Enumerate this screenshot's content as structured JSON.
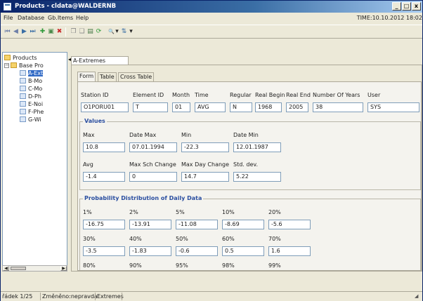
{
  "window": {
    "title": "Products - cldata@WALDERNB",
    "minimize": "_",
    "maximize": "□",
    "close": "x"
  },
  "menu": {
    "items": [
      "File",
      "Database",
      "Gb.Items",
      "Help"
    ],
    "time_display": "TIME:10.10.2012 18:02"
  },
  "toolbar": {
    "buttons": [
      {
        "icon": "first-record-icon",
        "glyph": "⏮"
      },
      {
        "icon": "prev-record-icon",
        "glyph": "◀"
      },
      {
        "icon": "next-record-icon",
        "glyph": "▶"
      },
      {
        "icon": "last-record-icon",
        "glyph": "⏭"
      },
      {
        "icon": "add-record-icon",
        "glyph": "✚"
      },
      {
        "icon": "save-record-icon",
        "glyph": "▣"
      },
      {
        "icon": "delete-record-icon",
        "glyph": "✖"
      },
      {
        "icon": "copy-icon",
        "glyph": "❐"
      },
      {
        "icon": "paste-icon",
        "glyph": "❑"
      },
      {
        "icon": "print-icon",
        "glyph": "▤"
      },
      {
        "icon": "refresh-icon",
        "glyph": "⟳"
      },
      {
        "icon": "search-icon",
        "glyph": "🔍"
      },
      {
        "icon": "filter-icon",
        "glyph": "▾"
      },
      {
        "icon": "sort-icon",
        "glyph": "⇅"
      },
      {
        "icon": "dropdown-icon",
        "glyph": "▾"
      }
    ]
  },
  "tree": {
    "root": "Products",
    "child": "Base Pro",
    "items": [
      "A-Ext",
      "B-Mo",
      "C-Mo",
      "D-Ph",
      "E-Noi",
      "F-Phe",
      "G-Wi"
    ],
    "selected_index": 0
  },
  "document_tab": "A-Extremes",
  "subtabs": [
    "Form",
    "Table",
    "Cross Table"
  ],
  "header_fields": {
    "labels": [
      "Station ID",
      "Element ID",
      "Month",
      "Time",
      "Regular",
      "Real Begin",
      "Real End",
      "Number Of Years",
      "User"
    ],
    "values": [
      "O1PORU01",
      "T",
      "01",
      "AVG",
      "N",
      "1968",
      "2005",
      "38",
      "SYS"
    ]
  },
  "values_group": {
    "title": "Values",
    "row1_labels": [
      "Max",
      "Date Max",
      "Min",
      "Date Min"
    ],
    "row1_values": [
      "10.8",
      "07.01.1994",
      "-22.3",
      "12.01.1987"
    ],
    "row2_labels": [
      "Avg",
      "Max Sch Change",
      "Max Day Change",
      "Std. dev."
    ],
    "row2_values": [
      "-1.4",
      "0",
      "14.7",
      "5.22"
    ]
  },
  "probability_group": {
    "title": "Probability Distribution of Daily Data",
    "row1_labels": [
      "1%",
      "2%",
      "5%",
      "10%",
      "20%"
    ],
    "row1_values": [
      "-16.75",
      "-13.91",
      "-11.08",
      "-8.69",
      "-5.6"
    ],
    "row2_labels": [
      "30%",
      "40%",
      "50%",
      "60%",
      "70%"
    ],
    "row2_values": [
      "-3.5",
      "-1.83",
      "-0.6",
      "0.5",
      "1.6"
    ],
    "row3_labels": [
      "80%",
      "90%",
      "95%",
      "98%",
      "99%"
    ]
  },
  "status": {
    "record": "řádek 1/25",
    "change": "Změněno:nepravda",
    "table": "Extremes"
  }
}
